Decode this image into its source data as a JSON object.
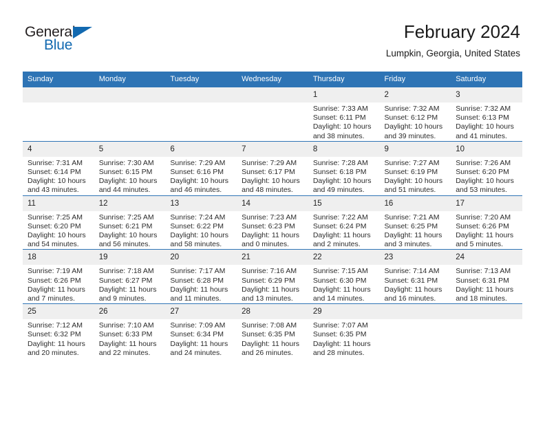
{
  "brand": {
    "name_part1": "General",
    "name_part2": "Blue",
    "triangle_icon": "triangle-icon",
    "blue": "#1269b0"
  },
  "header": {
    "title": "February 2024",
    "subtitle": "Lumpkin, Georgia, United States"
  },
  "theme": {
    "header_blue": "#2e74b5",
    "daynum_band": "#efefef",
    "text": "#2b2b2b"
  },
  "weekday_headers": [
    "Sunday",
    "Monday",
    "Tuesday",
    "Wednesday",
    "Thursday",
    "Friday",
    "Saturday"
  ],
  "weeks": [
    {
      "days": [
        {
          "num": "",
          "empty": true,
          "sunrise": "",
          "sunset": "",
          "daylight1": "",
          "daylight2": ""
        },
        {
          "num": "",
          "empty": true,
          "sunrise": "",
          "sunset": "",
          "daylight1": "",
          "daylight2": ""
        },
        {
          "num": "",
          "empty": true,
          "sunrise": "",
          "sunset": "",
          "daylight1": "",
          "daylight2": ""
        },
        {
          "num": "",
          "empty": true,
          "sunrise": "",
          "sunset": "",
          "daylight1": "",
          "daylight2": ""
        },
        {
          "num": "1",
          "empty": false,
          "sunrise": "Sunrise: 7:33 AM",
          "sunset": "Sunset: 6:11 PM",
          "daylight1": "Daylight: 10 hours",
          "daylight2": "and 38 minutes."
        },
        {
          "num": "2",
          "empty": false,
          "sunrise": "Sunrise: 7:32 AM",
          "sunset": "Sunset: 6:12 PM",
          "daylight1": "Daylight: 10 hours",
          "daylight2": "and 39 minutes."
        },
        {
          "num": "3",
          "empty": false,
          "sunrise": "Sunrise: 7:32 AM",
          "sunset": "Sunset: 6:13 PM",
          "daylight1": "Daylight: 10 hours",
          "daylight2": "and 41 minutes."
        }
      ]
    },
    {
      "days": [
        {
          "num": "4",
          "empty": false,
          "sunrise": "Sunrise: 7:31 AM",
          "sunset": "Sunset: 6:14 PM",
          "daylight1": "Daylight: 10 hours",
          "daylight2": "and 43 minutes."
        },
        {
          "num": "5",
          "empty": false,
          "sunrise": "Sunrise: 7:30 AM",
          "sunset": "Sunset: 6:15 PM",
          "daylight1": "Daylight: 10 hours",
          "daylight2": "and 44 minutes."
        },
        {
          "num": "6",
          "empty": false,
          "sunrise": "Sunrise: 7:29 AM",
          "sunset": "Sunset: 6:16 PM",
          "daylight1": "Daylight: 10 hours",
          "daylight2": "and 46 minutes."
        },
        {
          "num": "7",
          "empty": false,
          "sunrise": "Sunrise: 7:29 AM",
          "sunset": "Sunset: 6:17 PM",
          "daylight1": "Daylight: 10 hours",
          "daylight2": "and 48 minutes."
        },
        {
          "num": "8",
          "empty": false,
          "sunrise": "Sunrise: 7:28 AM",
          "sunset": "Sunset: 6:18 PM",
          "daylight1": "Daylight: 10 hours",
          "daylight2": "and 49 minutes."
        },
        {
          "num": "9",
          "empty": false,
          "sunrise": "Sunrise: 7:27 AM",
          "sunset": "Sunset: 6:19 PM",
          "daylight1": "Daylight: 10 hours",
          "daylight2": "and 51 minutes."
        },
        {
          "num": "10",
          "empty": false,
          "sunrise": "Sunrise: 7:26 AM",
          "sunset": "Sunset: 6:20 PM",
          "daylight1": "Daylight: 10 hours",
          "daylight2": "and 53 minutes."
        }
      ]
    },
    {
      "days": [
        {
          "num": "11",
          "empty": false,
          "sunrise": "Sunrise: 7:25 AM",
          "sunset": "Sunset: 6:20 PM",
          "daylight1": "Daylight: 10 hours",
          "daylight2": "and 54 minutes."
        },
        {
          "num": "12",
          "empty": false,
          "sunrise": "Sunrise: 7:25 AM",
          "sunset": "Sunset: 6:21 PM",
          "daylight1": "Daylight: 10 hours",
          "daylight2": "and 56 minutes."
        },
        {
          "num": "13",
          "empty": false,
          "sunrise": "Sunrise: 7:24 AM",
          "sunset": "Sunset: 6:22 PM",
          "daylight1": "Daylight: 10 hours",
          "daylight2": "and 58 minutes."
        },
        {
          "num": "14",
          "empty": false,
          "sunrise": "Sunrise: 7:23 AM",
          "sunset": "Sunset: 6:23 PM",
          "daylight1": "Daylight: 11 hours",
          "daylight2": "and 0 minutes."
        },
        {
          "num": "15",
          "empty": false,
          "sunrise": "Sunrise: 7:22 AM",
          "sunset": "Sunset: 6:24 PM",
          "daylight1": "Daylight: 11 hours",
          "daylight2": "and 2 minutes."
        },
        {
          "num": "16",
          "empty": false,
          "sunrise": "Sunrise: 7:21 AM",
          "sunset": "Sunset: 6:25 PM",
          "daylight1": "Daylight: 11 hours",
          "daylight2": "and 3 minutes."
        },
        {
          "num": "17",
          "empty": false,
          "sunrise": "Sunrise: 7:20 AM",
          "sunset": "Sunset: 6:26 PM",
          "daylight1": "Daylight: 11 hours",
          "daylight2": "and 5 minutes."
        }
      ]
    },
    {
      "days": [
        {
          "num": "18",
          "empty": false,
          "sunrise": "Sunrise: 7:19 AM",
          "sunset": "Sunset: 6:26 PM",
          "daylight1": "Daylight: 11 hours",
          "daylight2": "and 7 minutes."
        },
        {
          "num": "19",
          "empty": false,
          "sunrise": "Sunrise: 7:18 AM",
          "sunset": "Sunset: 6:27 PM",
          "daylight1": "Daylight: 11 hours",
          "daylight2": "and 9 minutes."
        },
        {
          "num": "20",
          "empty": false,
          "sunrise": "Sunrise: 7:17 AM",
          "sunset": "Sunset: 6:28 PM",
          "daylight1": "Daylight: 11 hours",
          "daylight2": "and 11 minutes."
        },
        {
          "num": "21",
          "empty": false,
          "sunrise": "Sunrise: 7:16 AM",
          "sunset": "Sunset: 6:29 PM",
          "daylight1": "Daylight: 11 hours",
          "daylight2": "and 13 minutes."
        },
        {
          "num": "22",
          "empty": false,
          "sunrise": "Sunrise: 7:15 AM",
          "sunset": "Sunset: 6:30 PM",
          "daylight1": "Daylight: 11 hours",
          "daylight2": "and 14 minutes."
        },
        {
          "num": "23",
          "empty": false,
          "sunrise": "Sunrise: 7:14 AM",
          "sunset": "Sunset: 6:31 PM",
          "daylight1": "Daylight: 11 hours",
          "daylight2": "and 16 minutes."
        },
        {
          "num": "24",
          "empty": false,
          "sunrise": "Sunrise: 7:13 AM",
          "sunset": "Sunset: 6:31 PM",
          "daylight1": "Daylight: 11 hours",
          "daylight2": "and 18 minutes."
        }
      ]
    },
    {
      "days": [
        {
          "num": "25",
          "empty": false,
          "sunrise": "Sunrise: 7:12 AM",
          "sunset": "Sunset: 6:32 PM",
          "daylight1": "Daylight: 11 hours",
          "daylight2": "and 20 minutes."
        },
        {
          "num": "26",
          "empty": false,
          "sunrise": "Sunrise: 7:10 AM",
          "sunset": "Sunset: 6:33 PM",
          "daylight1": "Daylight: 11 hours",
          "daylight2": "and 22 minutes."
        },
        {
          "num": "27",
          "empty": false,
          "sunrise": "Sunrise: 7:09 AM",
          "sunset": "Sunset: 6:34 PM",
          "daylight1": "Daylight: 11 hours",
          "daylight2": "and 24 minutes."
        },
        {
          "num": "28",
          "empty": false,
          "sunrise": "Sunrise: 7:08 AM",
          "sunset": "Sunset: 6:35 PM",
          "daylight1": "Daylight: 11 hours",
          "daylight2": "and 26 minutes."
        },
        {
          "num": "29",
          "empty": false,
          "sunrise": "Sunrise: 7:07 AM",
          "sunset": "Sunset: 6:35 PM",
          "daylight1": "Daylight: 11 hours",
          "daylight2": "and 28 minutes."
        },
        {
          "num": "",
          "empty": true,
          "sunrise": "",
          "sunset": "",
          "daylight1": "",
          "daylight2": ""
        },
        {
          "num": "",
          "empty": true,
          "sunrise": "",
          "sunset": "",
          "daylight1": "",
          "daylight2": ""
        }
      ]
    }
  ]
}
